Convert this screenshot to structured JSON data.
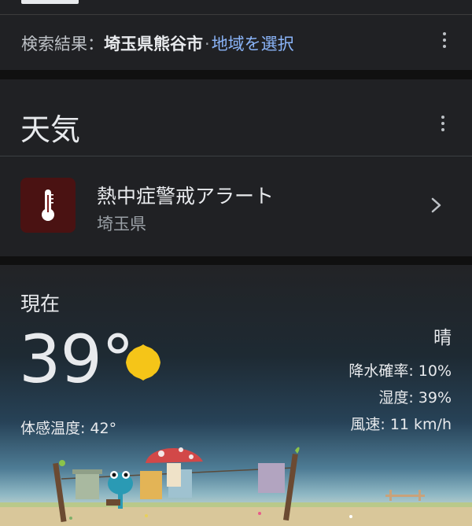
{
  "search": {
    "prefix": "検索結果：",
    "place": "埼玉県熊谷市",
    "separator": "·",
    "choose_region": "地域を選択"
  },
  "weather_card": {
    "title": "天気",
    "alert": {
      "title": "熱中症警戒アラート",
      "region": "埼玉県",
      "icon": "thermometer-icon",
      "color": "#4a1212"
    }
  },
  "current": {
    "label": "現在",
    "temperature": "39°",
    "condition_icon": "sun-icon",
    "feels_like": "体感温度: 42°",
    "condition": "晴",
    "precipitation": "降水確率: 10%",
    "humidity": "湿度: 39%",
    "wind": "風速: 11 km/h"
  },
  "colors": {
    "link": "#8ab4f8",
    "sun": "#f5c518",
    "card_bg": "#202124"
  }
}
